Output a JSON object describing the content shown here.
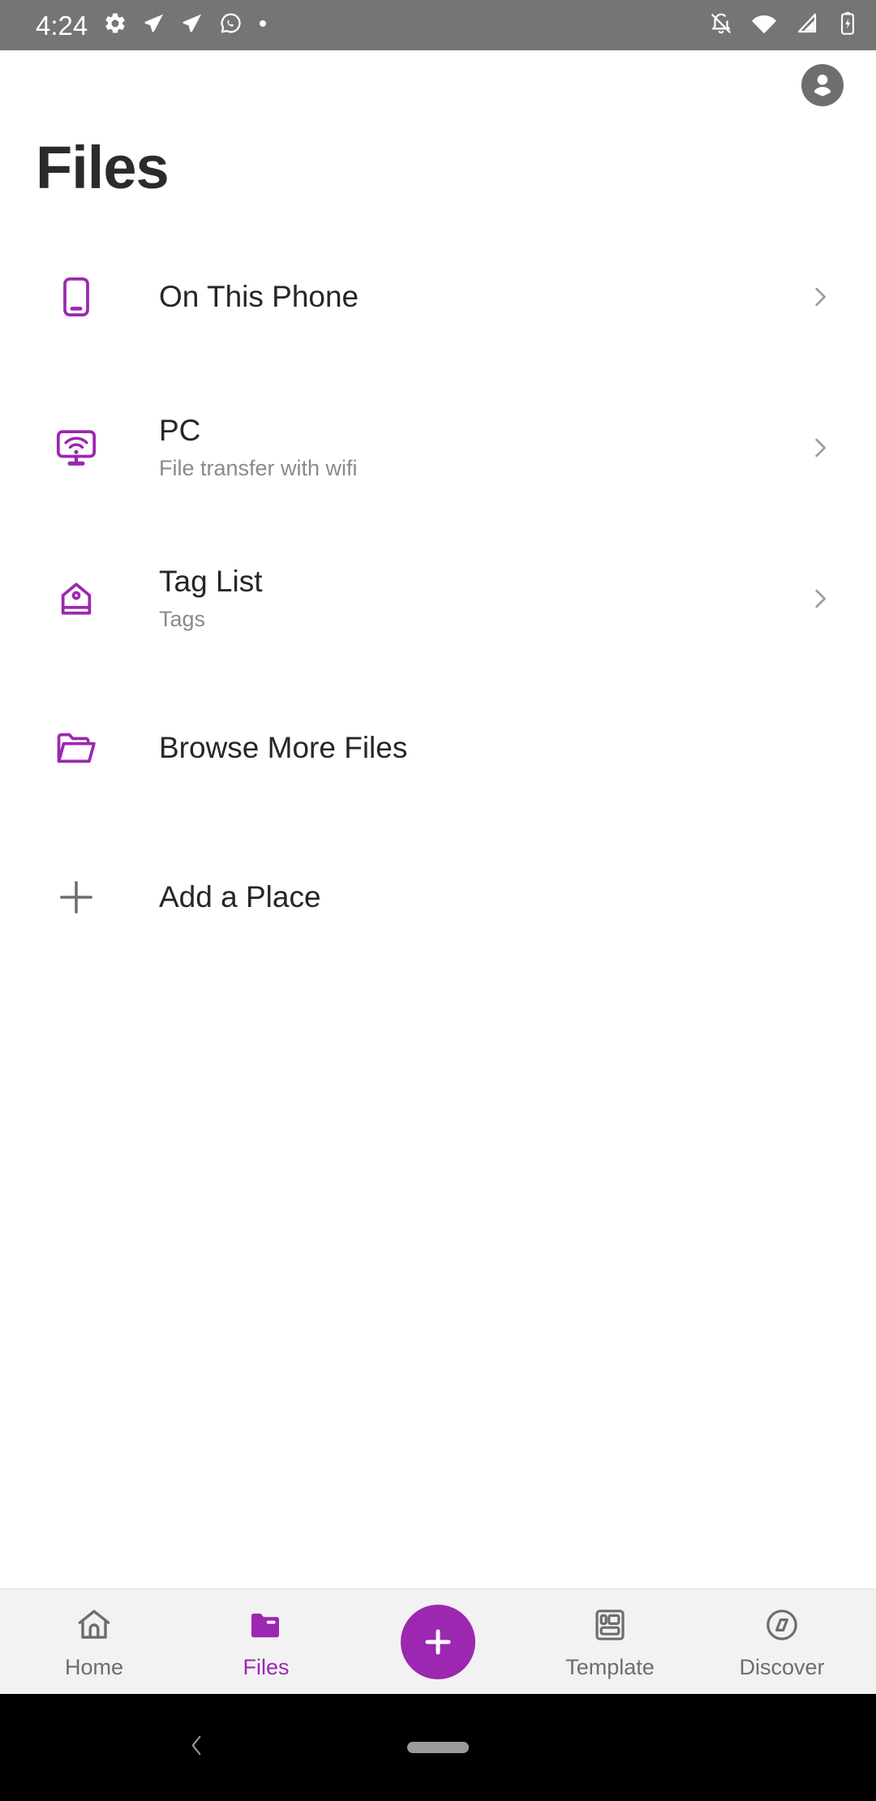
{
  "status_bar": {
    "time": "4:24",
    "left_icons": [
      "gear-icon",
      "paper-plane-icon",
      "paper-plane-icon",
      "whatsapp-icon",
      "dot-icon"
    ],
    "right_icons": [
      "notifications-off-icon",
      "wifi-icon",
      "cellular-signal-icon",
      "battery-charging-icon"
    ],
    "background_color": "#757575"
  },
  "header": {
    "title": "Files",
    "avatar_name": "account-avatar"
  },
  "list": {
    "items": [
      {
        "id": "on-this-phone",
        "icon": "phone-icon",
        "title": "On This Phone",
        "subtitle": "",
        "chevron": true
      },
      {
        "id": "pc",
        "icon": "monitor-wifi-icon",
        "title": "PC",
        "subtitle": "File transfer with wifi",
        "chevron": true
      },
      {
        "id": "tag-list",
        "icon": "tag-icon",
        "title": "Tag List",
        "subtitle": "Tags",
        "chevron": true
      },
      {
        "id": "browse-more-files",
        "icon": "folder-open-icon",
        "title": "Browse More Files",
        "subtitle": "",
        "chevron": false
      },
      {
        "id": "add-a-place",
        "icon": "plus-icon",
        "title": "Add a Place",
        "subtitle": "",
        "chevron": false
      }
    ]
  },
  "bottom_nav": {
    "items": [
      {
        "id": "home",
        "icon": "home-icon",
        "label": "Home",
        "active": false
      },
      {
        "id": "files",
        "icon": "folder-icon",
        "label": "Files",
        "active": true
      },
      {
        "id": "create",
        "icon": "plus-icon",
        "label": "",
        "active": false
      },
      {
        "id": "template",
        "icon": "template-grid-icon",
        "label": "Template",
        "active": false
      },
      {
        "id": "discover",
        "icon": "compass-icon",
        "label": "Discover",
        "active": false
      }
    ],
    "background_color": "#f2f2f2"
  },
  "system_nav": {
    "back_icon": "back-chevron-icon",
    "home_pill": "home-pill-indicator",
    "background_color": "#000000"
  },
  "colors": {
    "accent_purple": "#9c27b0",
    "icon_purple": "#9c27b0",
    "title_dark": "#2b2b2b",
    "body_dark": "#262626",
    "muted_gray": "#8a8a8a",
    "nav_gray": "#6d6d6d"
  }
}
